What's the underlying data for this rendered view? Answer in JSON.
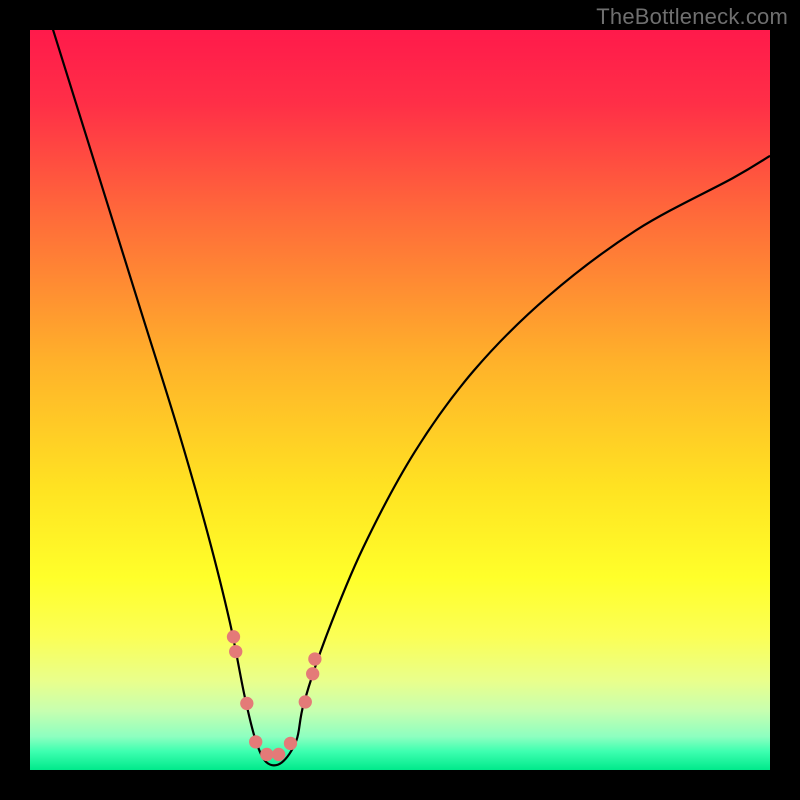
{
  "watermark": "TheBottleneck.com",
  "chart_data": {
    "type": "line",
    "title": "",
    "xlabel": "",
    "ylabel": "",
    "xlim": [
      0,
      100
    ],
    "ylim": [
      0,
      100
    ],
    "background_gradient_stops": [
      {
        "offset": 0.0,
        "color": "#ff1a4b"
      },
      {
        "offset": 0.1,
        "color": "#ff2f47"
      },
      {
        "offset": 0.25,
        "color": "#ff6a3a"
      },
      {
        "offset": 0.45,
        "color": "#ffb22a"
      },
      {
        "offset": 0.62,
        "color": "#ffe322"
      },
      {
        "offset": 0.74,
        "color": "#ffff2a"
      },
      {
        "offset": 0.82,
        "color": "#fbff56"
      },
      {
        "offset": 0.88,
        "color": "#e9ff8c"
      },
      {
        "offset": 0.92,
        "color": "#c7ffb0"
      },
      {
        "offset": 0.955,
        "color": "#8dffc0"
      },
      {
        "offset": 0.975,
        "color": "#3dffb0"
      },
      {
        "offset": 1.0,
        "color": "#00e98b"
      }
    ],
    "series": [
      {
        "name": "bottleneck-curve",
        "stroke": "#000000",
        "x": [
          0,
          5,
          10,
          15,
          20,
          24,
          27,
          29,
          30.5,
          32,
          34,
          36,
          37,
          40,
          45,
          52,
          60,
          70,
          82,
          95,
          100
        ],
        "values": [
          110,
          94,
          78,
          62,
          46,
          32,
          20,
          10,
          4,
          1,
          1,
          4,
          9,
          18,
          30,
          43,
          54,
          64,
          73,
          80,
          83
        ]
      }
    ],
    "markers": {
      "name": "trough-markers",
      "color": "#e47a78",
      "radius_pct": 0.9,
      "points": [
        {
          "x": 27.5,
          "y": 18
        },
        {
          "x": 27.8,
          "y": 16
        },
        {
          "x": 29.3,
          "y": 9
        },
        {
          "x": 30.5,
          "y": 3.8
        },
        {
          "x": 32.0,
          "y": 2.1
        },
        {
          "x": 33.6,
          "y": 2.1
        },
        {
          "x": 35.2,
          "y": 3.6
        },
        {
          "x": 37.2,
          "y": 9.2
        },
        {
          "x": 38.2,
          "y": 13
        },
        {
          "x": 38.5,
          "y": 15
        }
      ]
    }
  }
}
